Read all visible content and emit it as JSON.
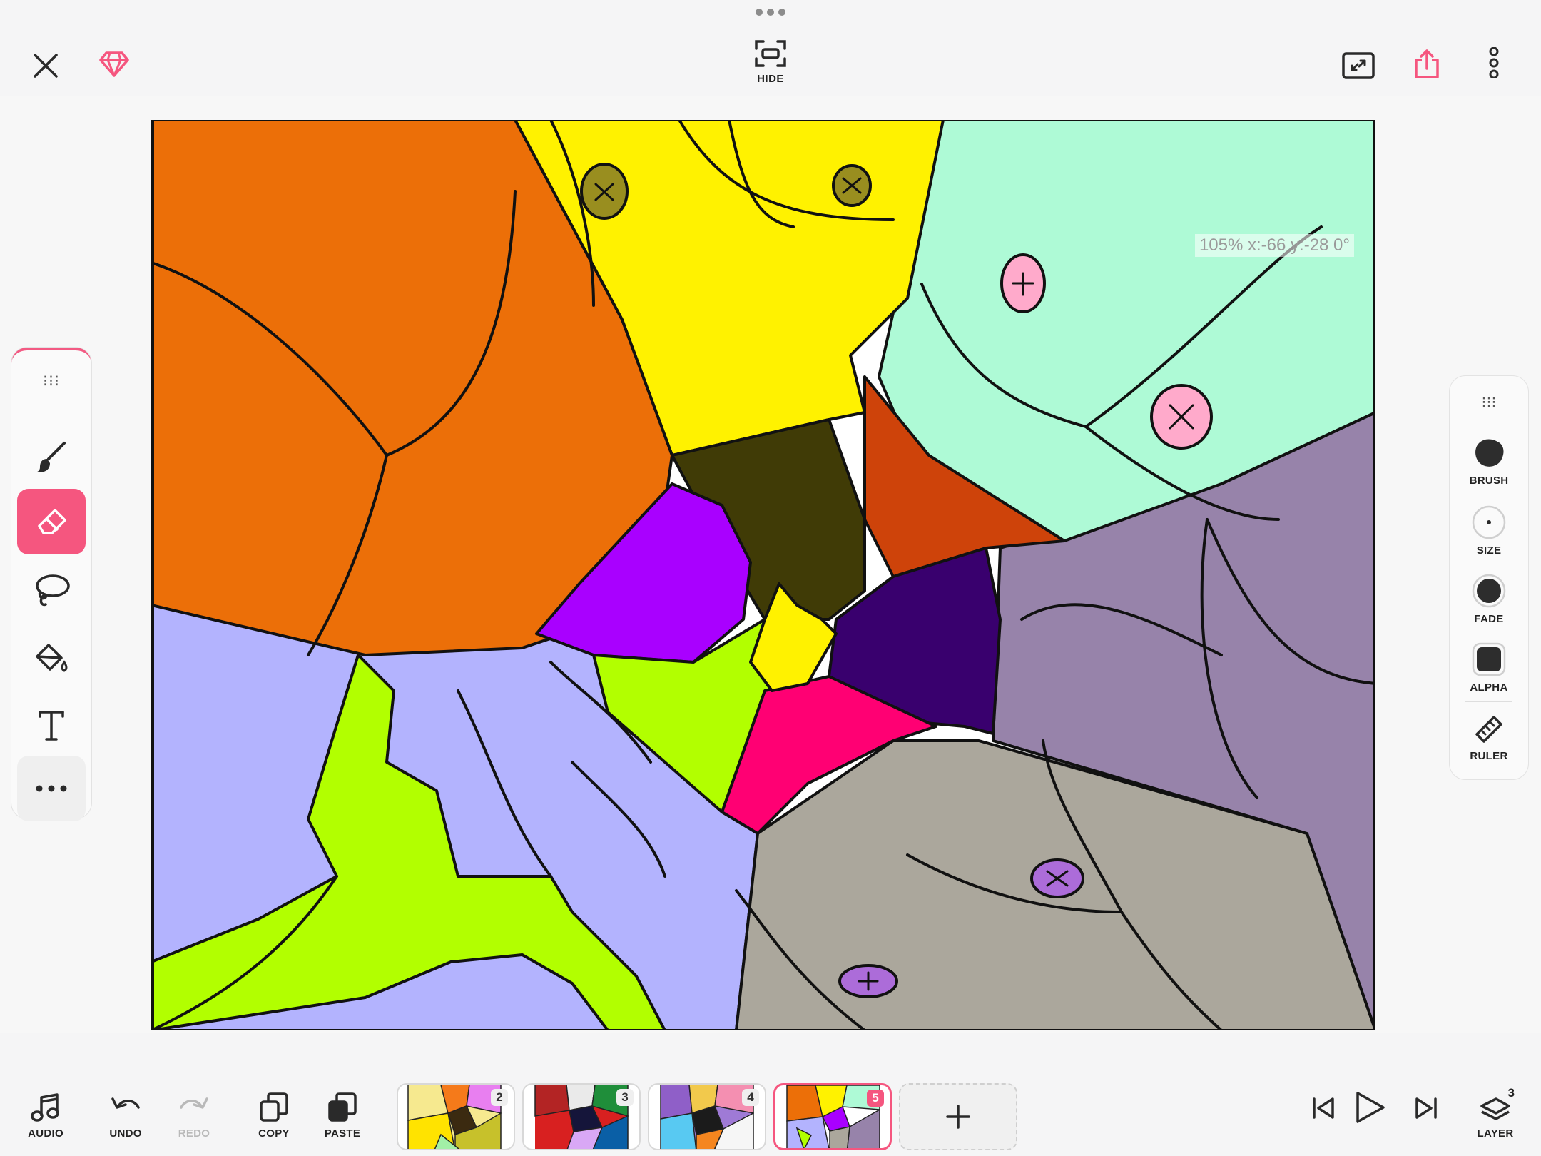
{
  "topbar": {
    "hide_label": "HIDE",
    "icons": [
      "close-icon",
      "diamond-icon",
      "hide-frame-icon",
      "fullscreen-icon",
      "share-icon",
      "more-vertical-icon"
    ],
    "accent_color": "#f5567f"
  },
  "canvas": {
    "readout": "105% x:-66 y:-28 0°"
  },
  "left_tools": {
    "items": [
      "brush-icon",
      "eraser-icon",
      "lasso-icon",
      "fill-bucket-icon",
      "text-tool-icon",
      "more-horizontal-icon"
    ],
    "active": "eraser-icon"
  },
  "right_panel": {
    "brush_label": "BRUSH",
    "size_label": "SIZE",
    "fade_label": "FADE",
    "alpha_label": "ALPHA",
    "ruler_label": "RULER"
  },
  "bottombar": {
    "audio_label": "AUDIO",
    "undo_label": "UNDO",
    "redo_label": "REDO",
    "copy_label": "COPY",
    "paste_label": "PASTE",
    "layer_label": "LAYER",
    "layer_count": "3",
    "frames": [
      {
        "number": "2"
      },
      {
        "number": "3"
      },
      {
        "number": "4"
      },
      {
        "number": "5"
      }
    ],
    "active_frame": "5"
  }
}
